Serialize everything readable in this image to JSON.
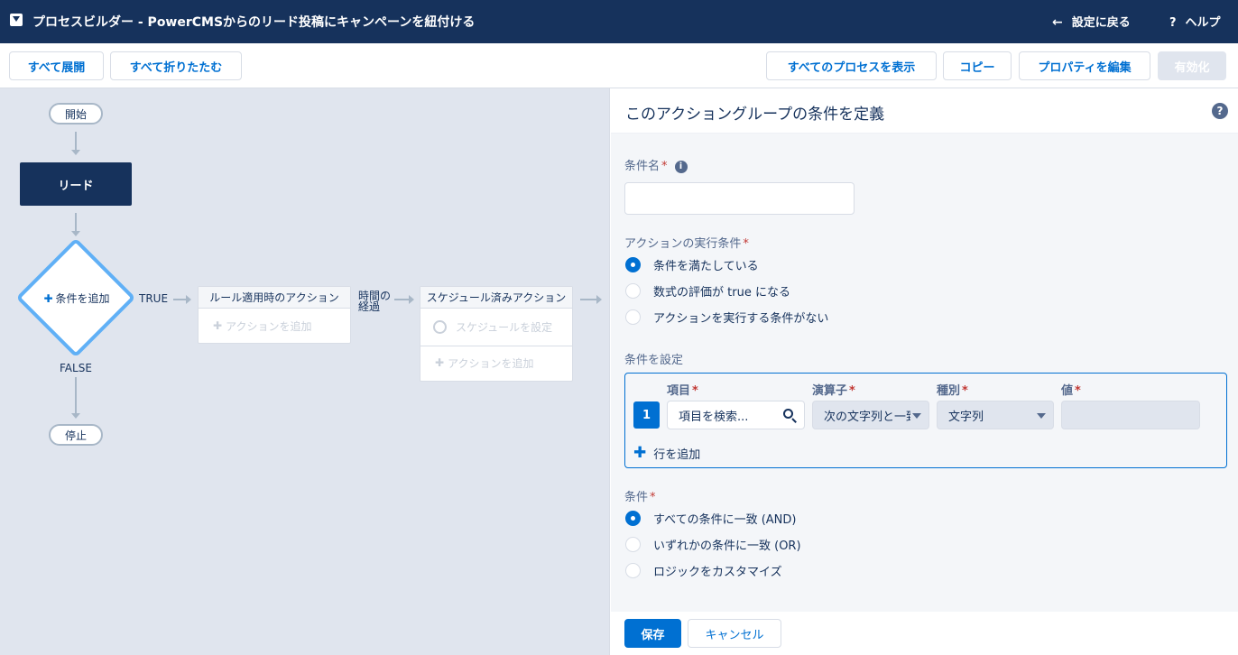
{
  "header": {
    "title": "プロセスビルダー - PowerCMSからのリード投稿にキャンペーンを紐付ける",
    "back_label": "設定に戻る",
    "help_label": "ヘルプ"
  },
  "toolbar": {
    "expand_all": "すべて展開",
    "collapse_all": "すべて折りたたむ",
    "show_all_processes": "すべてのプロセスを表示",
    "copy": "コピー",
    "edit_properties": "プロパティを編集",
    "activate": "有効化"
  },
  "flow": {
    "start": "開始",
    "object": "リード",
    "add_criteria": "条件を追加",
    "true_label": "TRUE",
    "false_label": "FALSE",
    "stop": "停止",
    "immediate_actions": {
      "title": "ルール適用時のアクション",
      "add_action": "アクションを追加"
    },
    "time_elapsed": [
      "時間の",
      "経過"
    ],
    "scheduled_actions": {
      "title": "スケジュール済みアクション",
      "set_schedule": "スケジュールを設定",
      "add_action": "アクションを追加"
    }
  },
  "panel": {
    "title": "このアクショングループの条件を定義",
    "criteria_name_label": "条件名",
    "criteria_name_value": "",
    "execute_label": "アクションの実行条件",
    "execute_options": [
      {
        "label": "条件を満たしている",
        "selected": true
      },
      {
        "label": "数式の評価が true になる",
        "selected": false
      },
      {
        "label": "アクションを実行する条件がない",
        "selected": false
      }
    ],
    "set_conditions_label": "条件を設定",
    "columns": {
      "field": "項目",
      "operator": "演算子",
      "type": "種別",
      "value": "値"
    },
    "row": {
      "number": "1",
      "field_placeholder": "項目を検索...",
      "operator": "次の文字列と一致する",
      "type": "文字列",
      "value": ""
    },
    "add_row": "行を追加",
    "conditions_label": "条件",
    "conditions_options": [
      {
        "label": "すべての条件に一致 (AND)",
        "selected": true
      },
      {
        "label": "いずれかの条件に一致 (OR)",
        "selected": false
      },
      {
        "label": "ロジックをカスタマイズ",
        "selected": false
      }
    ],
    "save": "保存",
    "cancel": "キャンセル"
  },
  "colors": {
    "header_bg": "#16325c",
    "brand_blue": "#0070d2",
    "canvas_bg": "#e0e5ee",
    "diamond_border": "#60b0f6",
    "required": "#c23934"
  }
}
